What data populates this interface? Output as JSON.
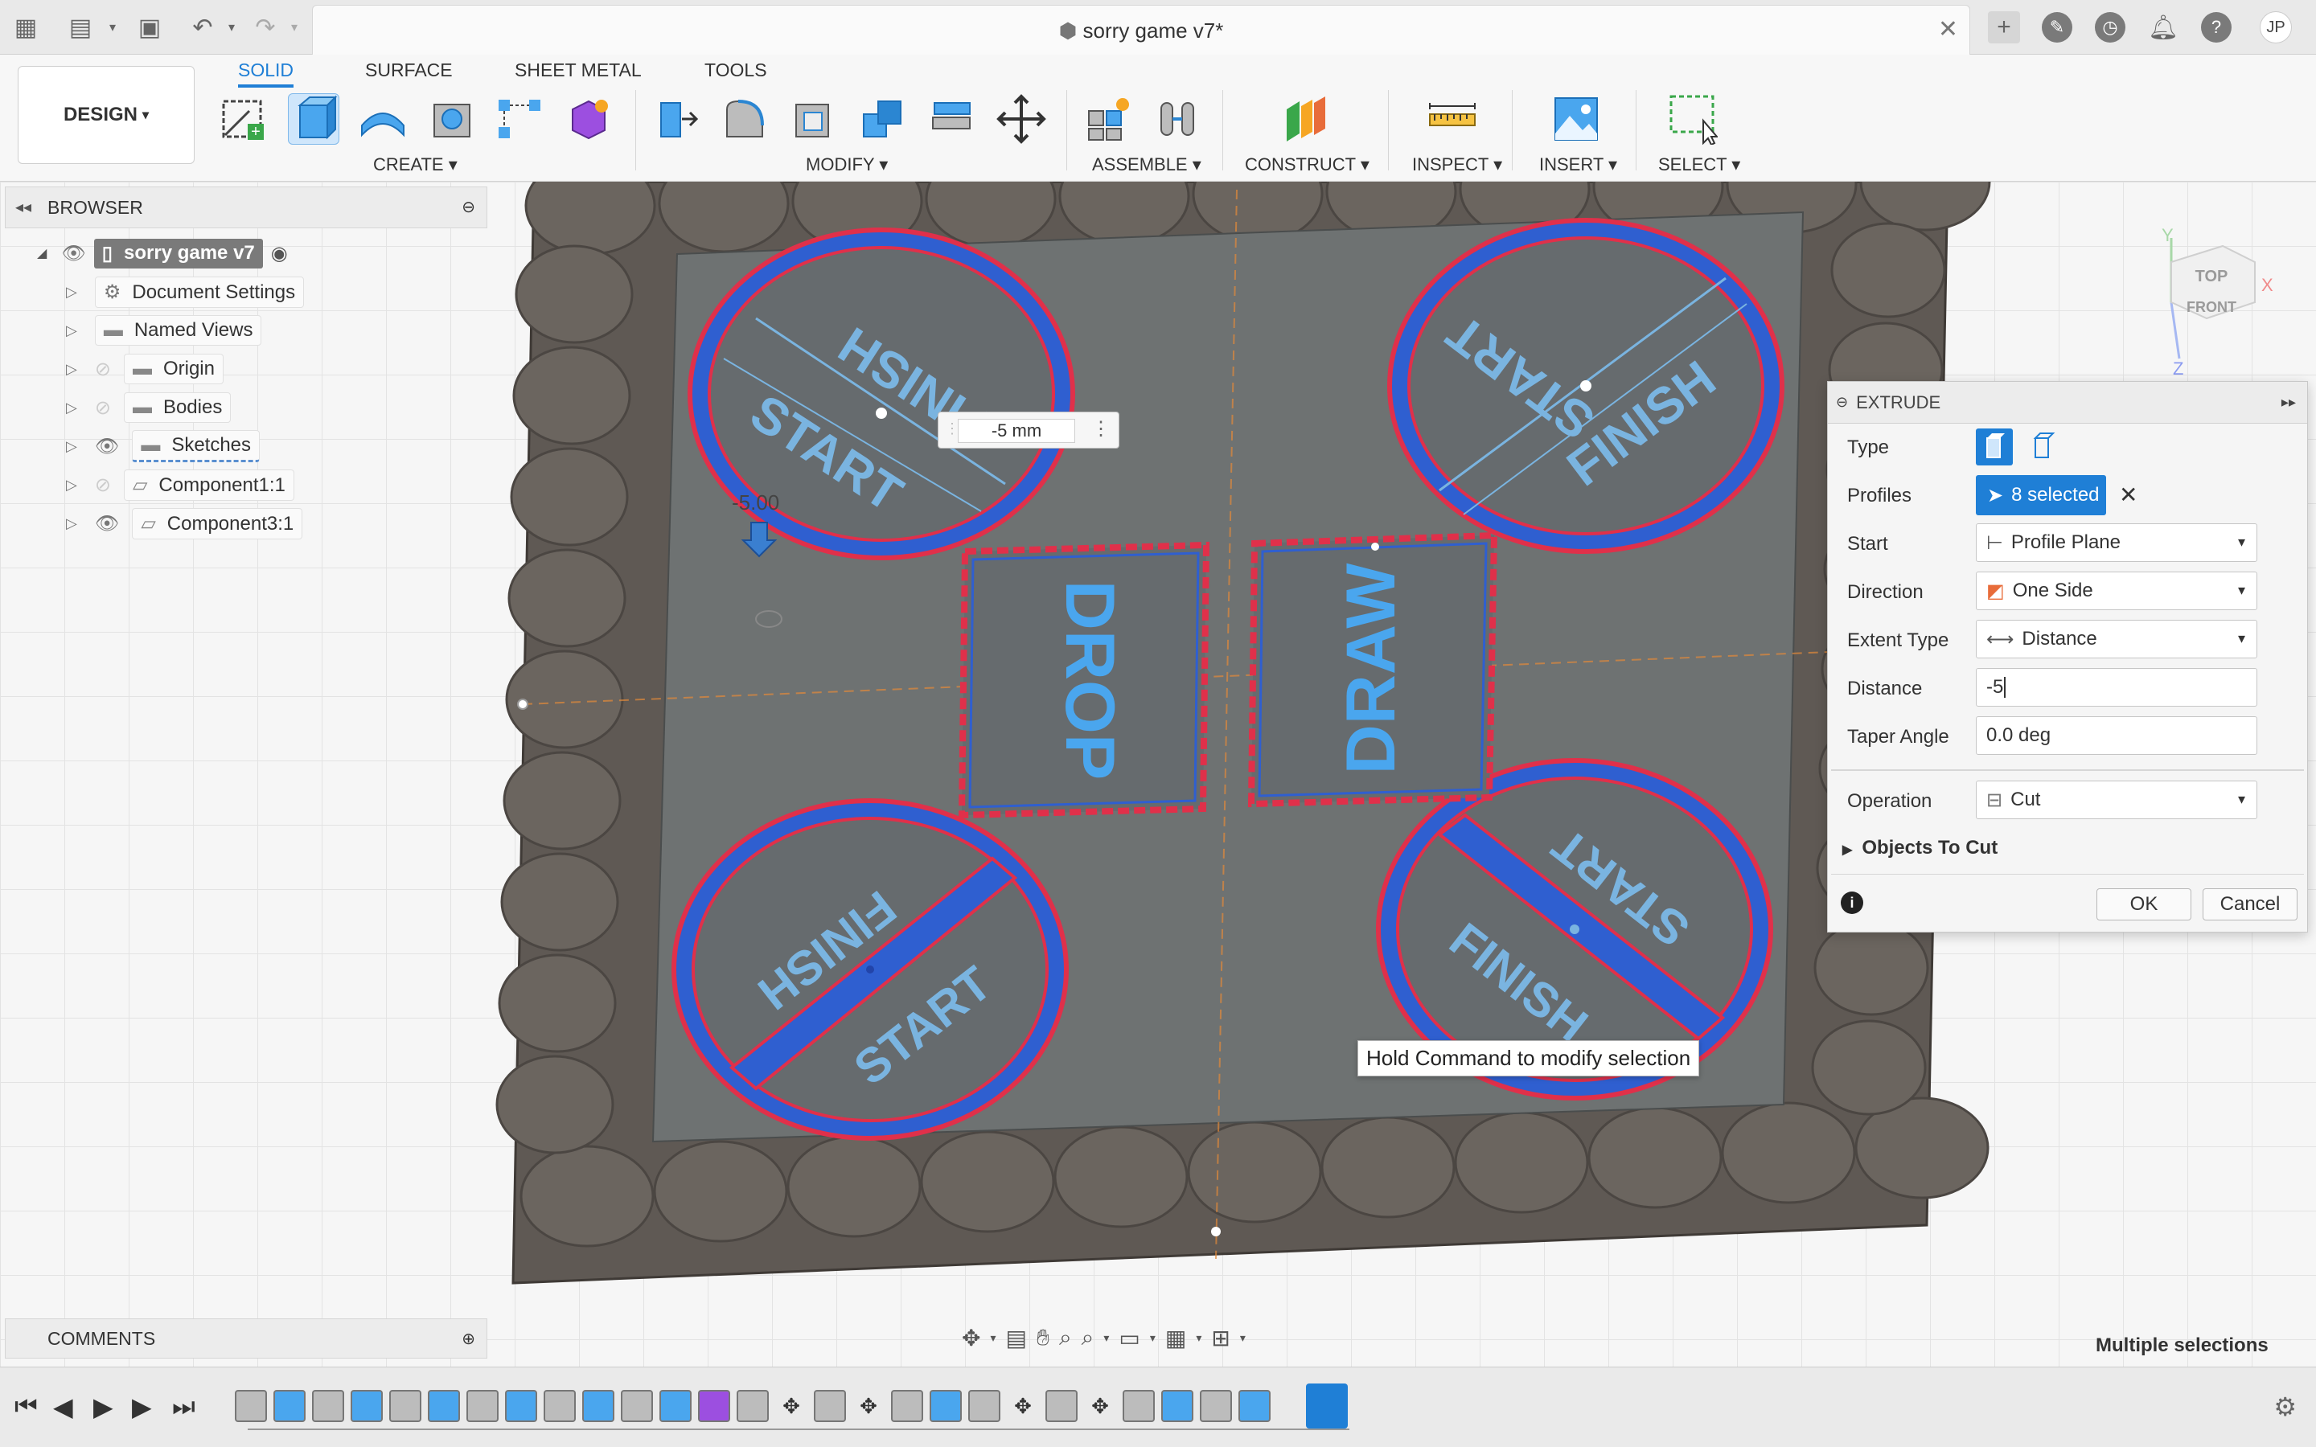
{
  "titlebar": {
    "document_title": "sorry game v7*",
    "user_initials": "JP",
    "icons": [
      "apps-grid-icon",
      "file-icon",
      "save-icon",
      "undo-icon",
      "redo-icon",
      "new-tab-icon",
      "extensions-icon",
      "job-status-icon",
      "notifications-icon",
      "help-icon"
    ]
  },
  "toolbar": {
    "workspace": "DESIGN",
    "tabs": [
      "SOLID",
      "SURFACE",
      "SHEET METAL",
      "TOOLS"
    ],
    "active_tab": "SOLID",
    "groups": [
      "CREATE",
      "MODIFY",
      "ASSEMBLE",
      "CONSTRUCT",
      "INSPECT",
      "INSERT",
      "SELECT"
    ]
  },
  "browser": {
    "header": "BROWSER",
    "root": "sorry game v7",
    "items": [
      {
        "label": "Document Settings"
      },
      {
        "label": "Named Views"
      },
      {
        "label": "Origin"
      },
      {
        "label": "Bodies"
      },
      {
        "label": "Sketches"
      },
      {
        "label": "Component1:1"
      },
      {
        "label": "Component3:1"
      }
    ]
  },
  "canvas": {
    "dimension_value": "-5 mm",
    "manipulator_value": "-5.00",
    "viewcube_top": "TOP",
    "viewcube_front": "FRONT",
    "axis_x": "X",
    "axis_y": "Y",
    "axis_z": "Z",
    "labels": {
      "tl_finish": "FINISH",
      "tl_start": "START",
      "tr_start": "START",
      "tr_finish": "FINISH",
      "bl_finish": "FINISH",
      "bl_start": "START",
      "br_start": "START",
      "br_finish": "FINISH",
      "drop": "DROP",
      "draw": "DRAW"
    }
  },
  "extrude": {
    "title": "EXTRUDE",
    "rows": {
      "type_label": "Type",
      "profiles_label": "Profiles",
      "profiles_value": "8 selected",
      "start_label": "Start",
      "start_value": "Profile Plane",
      "direction_label": "Direction",
      "direction_value": "One Side",
      "extent_label": "Extent Type",
      "extent_value": "Distance",
      "distance_label": "Distance",
      "distance_value": "-5",
      "taper_label": "Taper Angle",
      "taper_value": "0.0 deg",
      "operation_label": "Operation",
      "operation_value": "Cut",
      "objects_to_cut": "Objects To Cut"
    },
    "ok": "OK",
    "cancel": "Cancel"
  },
  "tooltip": "Hold Command to modify selection",
  "comments": "COMMENTS",
  "status": "Multiple selections",
  "colors": {
    "accent": "#1f7fd6",
    "board": "#6e7272",
    "border_disc": "#6b655f",
    "profile_blue": "#3a6fd0",
    "profile_red": "#e0304a"
  }
}
